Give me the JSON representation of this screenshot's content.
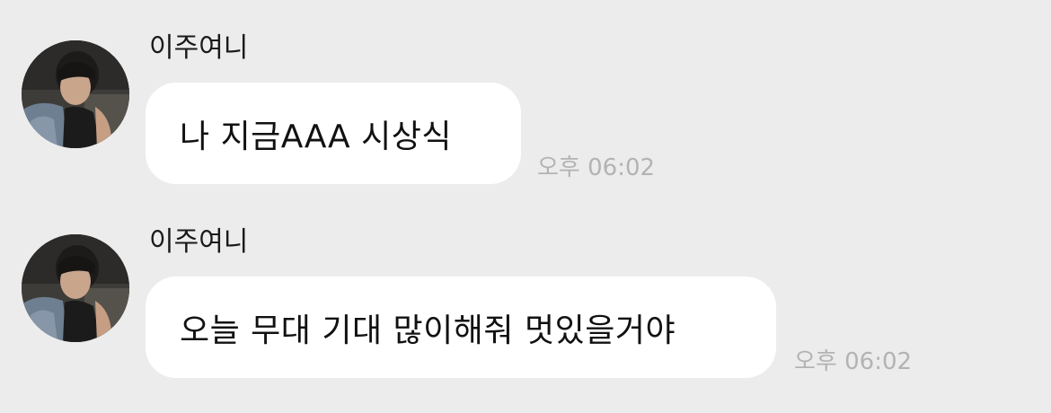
{
  "messages": [
    {
      "sender": "이주여니",
      "avatar_icon": "profile-photo-avatar",
      "text": "나 지금AAA 시상식",
      "time": "오후 06:02"
    },
    {
      "sender": "이주여니",
      "avatar_icon": "profile-photo-avatar",
      "text": "오늘 무대 기대 많이해줘 멋있을거야",
      "time": "오후 06:02"
    }
  ],
  "colors": {
    "background": "#ececec",
    "bubble": "#ffffff",
    "text": "#111111",
    "timestamp": "#b3b3b3"
  }
}
